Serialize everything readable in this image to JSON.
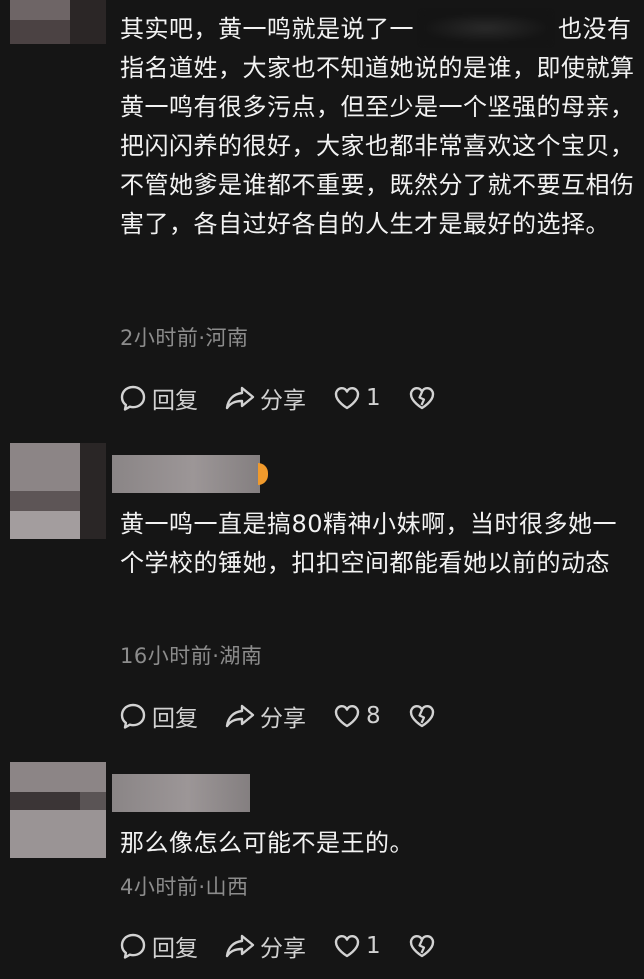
{
  "comments": [
    {
      "text_before": "其实吧，黄一鸣就是说了一",
      "text_after": "也没有指名道姓，大家也不知道她说的是谁，即使就算黄一鸣有很多污点，但至少是一个坚强的母亲，把闪闪养的很好，大家也都非常喜欢这个宝贝，不管她爹是谁都不重要，既然分了就不要互相伤害了，各自过好各自的人生才是最好的选择。",
      "meta": "2小时前·河南",
      "reply_label": "回复",
      "share_label": "分享",
      "like_count": "1"
    },
    {
      "text": "黄一鸣一直是搞80精神小妹啊，当时很多她一个学校的锤她，扣扣空间都能看她以前的动态",
      "meta": "16小时前·湖南",
      "reply_label": "回复",
      "share_label": "分享",
      "like_count": "8"
    },
    {
      "text": "那么像怎么可能不是王的。",
      "meta": "4小时前·山西",
      "reply_label": "回复",
      "share_label": "分享",
      "like_count": "1"
    }
  ],
  "colors": {
    "background": "#151515",
    "text": "#f2f2f2",
    "meta": "#8c8c8c",
    "action": "#d2d2d2",
    "badge": "#f09a2c"
  },
  "icons": [
    "reply-icon",
    "share-icon",
    "like-icon",
    "dislike-icon"
  ]
}
